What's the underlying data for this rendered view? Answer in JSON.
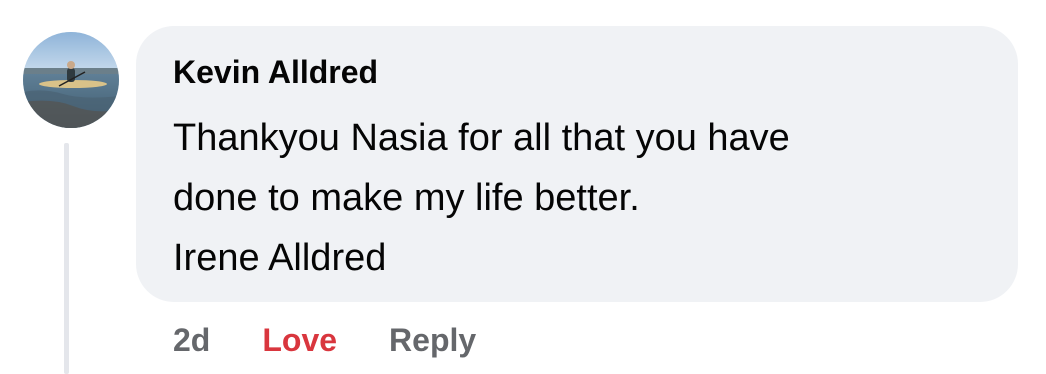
{
  "comment": {
    "author": "Kevin Alldred",
    "text_lines": [
      "Thankyou Nasia for all that you have",
      "done to make my life better.",
      "Irene Alldred"
    ],
    "avatar_description_icon": "avatar-kayak-photo"
  },
  "actions": {
    "time": "2d",
    "reaction_label": "Love",
    "reply_label": "Reply"
  },
  "colors": {
    "bubble": "#f0f2f5",
    "reaction_love": "#d9363e",
    "secondary_text": "#65676b",
    "primary_text": "#050505"
  }
}
